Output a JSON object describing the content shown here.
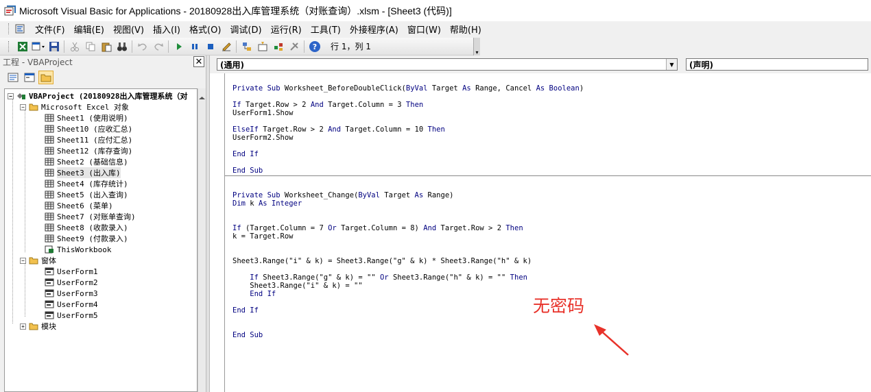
{
  "window": {
    "title": "Microsoft Visual Basic for Applications - 20180928出入库管理系统（对账查询）.xlsm - [Sheet3 (代码)]"
  },
  "menu": [
    "文件(F)",
    "编辑(E)",
    "视图(V)",
    "插入(I)",
    "格式(O)",
    "调试(D)",
    "运行(R)",
    "工具(T)",
    "外接程序(A)",
    "窗口(W)",
    "帮助(H)"
  ],
  "toolbar": {
    "position": "行 1，列 1"
  },
  "project": {
    "title": "工程 - VBAProject",
    "root": "VBAProject (20180928出入库管理系统（对",
    "excel_folder": "Microsoft Excel 对象",
    "sheets": [
      "Sheet1 (使用说明)",
      "Sheet10 (应收汇总)",
      "Sheet11 (应付汇总)",
      "Sheet12 (库存查询)",
      "Sheet2 (基础信息)",
      "Sheet3 (出入库)",
      "Sheet4 (库存统计)",
      "Sheet5 (出入查询)",
      "Sheet6 (菜单)",
      "Sheet7 (对账单查询)",
      "Sheet8 (收款录入)",
      "Sheet9 (付款录入)",
      "ThisWorkbook"
    ],
    "forms_folder": "窗体",
    "forms": [
      "UserForm1",
      "UserForm2",
      "UserForm3",
      "UserForm4",
      "UserForm5"
    ],
    "modules_folder": "模块"
  },
  "code": {
    "object_combo": "(通用)",
    "proc_combo": "(声明)",
    "lines1": [
      "Private Sub Worksheet_BeforeDoubleClick(ByVal Target As Range, Cancel As Boolean)",
      "",
      "If Target.Row > 2 And Target.Column = 3 Then",
      "UserForm1.Show",
      "",
      "ElseIf Target.Row > 2 And Target.Column = 10 Then",
      "UserForm2.Show",
      "",
      "End If",
      "",
      "End Sub"
    ],
    "lines2": [
      "Private Sub Worksheet_Change(ByVal Target As Range)",
      "Dim k As Integer",
      "",
      "",
      "If (Target.Column = 7 Or Target.Column = 8) And Target.Row > 2 Then",
      "k = Target.Row",
      "",
      "",
      "Sheet3.Range(\"i\" & k) = Sheet3.Range(\"g\" & k) * Sheet3.Range(\"h\" & k)",
      "",
      "    If Sheet3.Range(\"g\" & k) = \"\" Or Sheet3.Range(\"h\" & k) = \"\" Then",
      "    Sheet3.Range(\"i\" & k) = \"\"",
      "    End If",
      "",
      "End If",
      "",
      "",
      "End Sub"
    ]
  },
  "annotation": {
    "text": "无密码",
    "color": "#e8322a"
  }
}
